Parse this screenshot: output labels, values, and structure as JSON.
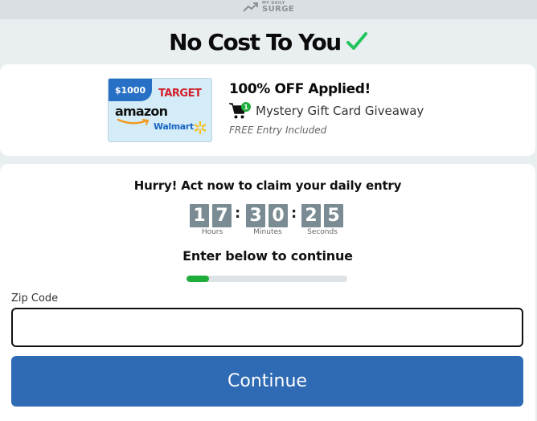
{
  "header": {
    "logo_small": "MY DAILY",
    "logo_big": "SURGE",
    "logo_icon": "trend-up-icon"
  },
  "headline": {
    "text": "No Cost To You",
    "icon": "checkmark-icon",
    "check_color": "#22c55e"
  },
  "offer": {
    "giftcard": {
      "amount": "$1000",
      "brand1": "TARGET",
      "brand2": "amazon",
      "brand3": "Walmart"
    },
    "title": "100% OFF Applied!",
    "cart_badge": "1",
    "subtitle": "Mystery Gift Card Giveaway",
    "note": "FREE Entry Included"
  },
  "timer": {
    "heading": "Hurry! Act now to claim your daily entry",
    "hours": [
      "1",
      "7"
    ],
    "minutes": [
      "3",
      "0"
    ],
    "seconds": [
      "2",
      "5"
    ],
    "separator": ":",
    "labels": {
      "hours": "Hours",
      "minutes": "Minutes",
      "seconds": "Seconds"
    }
  },
  "form": {
    "instruction": "Enter below to continue",
    "progress_fraction": 0.14,
    "progress_color": "#1fae3b",
    "zip_label": "Zip Code",
    "zip_value": "",
    "zip_placeholder": "",
    "continue_label": "Continue",
    "accent_color": "#2f6ab4"
  }
}
